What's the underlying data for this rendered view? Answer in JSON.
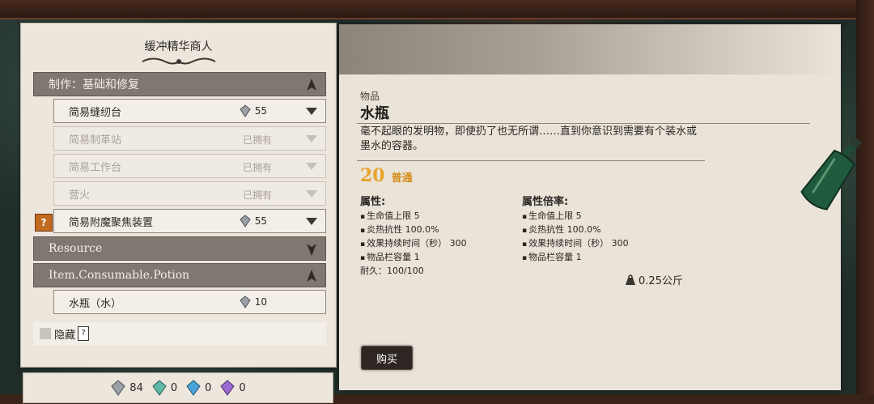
{
  "merchant": {
    "title": "缓冲精华商人"
  },
  "categories": [
    {
      "label": "制作：基础和修复"
    },
    {
      "label": "Resource"
    },
    {
      "label": "Item.Consumable.Potion"
    }
  ],
  "items": [
    {
      "label": "简易缝纫台",
      "price": "55"
    },
    {
      "label": "简易制革站",
      "status": "已拥有"
    },
    {
      "label": "简易工作台",
      "status": "已拥有"
    },
    {
      "label": "营火",
      "status": "已拥有"
    },
    {
      "label": "简易附魔聚焦装置",
      "price": "55"
    },
    {
      "label": "水瓶（水）",
      "price": "10"
    }
  ],
  "hide": {
    "label": "隐藏"
  },
  "currency": [
    {
      "amount": "84",
      "color": "#9aa0a6"
    },
    {
      "amount": "0",
      "color": "#5fb8a8"
    },
    {
      "amount": "0",
      "color": "#4aa4d8"
    },
    {
      "amount": "0",
      "color": "#9a6ad0"
    }
  ],
  "detail": {
    "category": "物品",
    "name": "水瓶",
    "description": "毫不起眼的发明物，即使扔了也无所谓……直到你意识到需要有个装水或墨水的容器。",
    "level": "20",
    "rarity": "普通",
    "attr_title": "属性:",
    "attr_mult_title": "属性倍率:",
    "attributes": [
      "生命值上限  5",
      "炎热抗性  100.0%",
      "效果持续时间（秒）  300",
      "物品栏容量  1"
    ],
    "attributes_mult": [
      "生命值上限  5",
      "炎热抗性  100.0%",
      "效果持续时间（秒）  300",
      "物品栏容量  1"
    ],
    "durability": "耐久：100/100",
    "weight": "0.25公斤",
    "buy_label": "购买"
  }
}
